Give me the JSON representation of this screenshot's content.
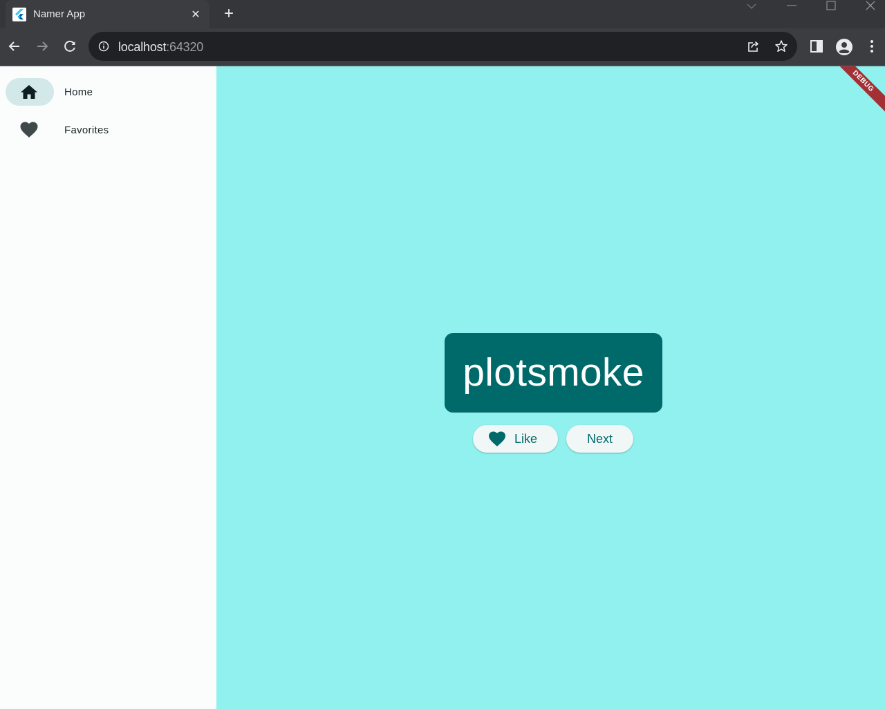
{
  "browser": {
    "tab_title": "Namer App",
    "tab_close": "✕",
    "new_tab": "+",
    "url_host": "localhost",
    "url_port": ":64320"
  },
  "app": {
    "nav": [
      {
        "label": "Home",
        "icon": "home-icon",
        "selected": true
      },
      {
        "label": "Favorites",
        "icon": "heart-icon",
        "selected": false
      }
    ],
    "current_word": "plotsmoke",
    "like_label": "Like",
    "next_label": "Next",
    "debug_banner": "DEBUG"
  },
  "colors": {
    "primary": "#00696a",
    "background": "#91f1ef",
    "rail": "#fbfdfd",
    "rail_indicator": "#d3e8e8",
    "debug_banner": "#a33034"
  }
}
